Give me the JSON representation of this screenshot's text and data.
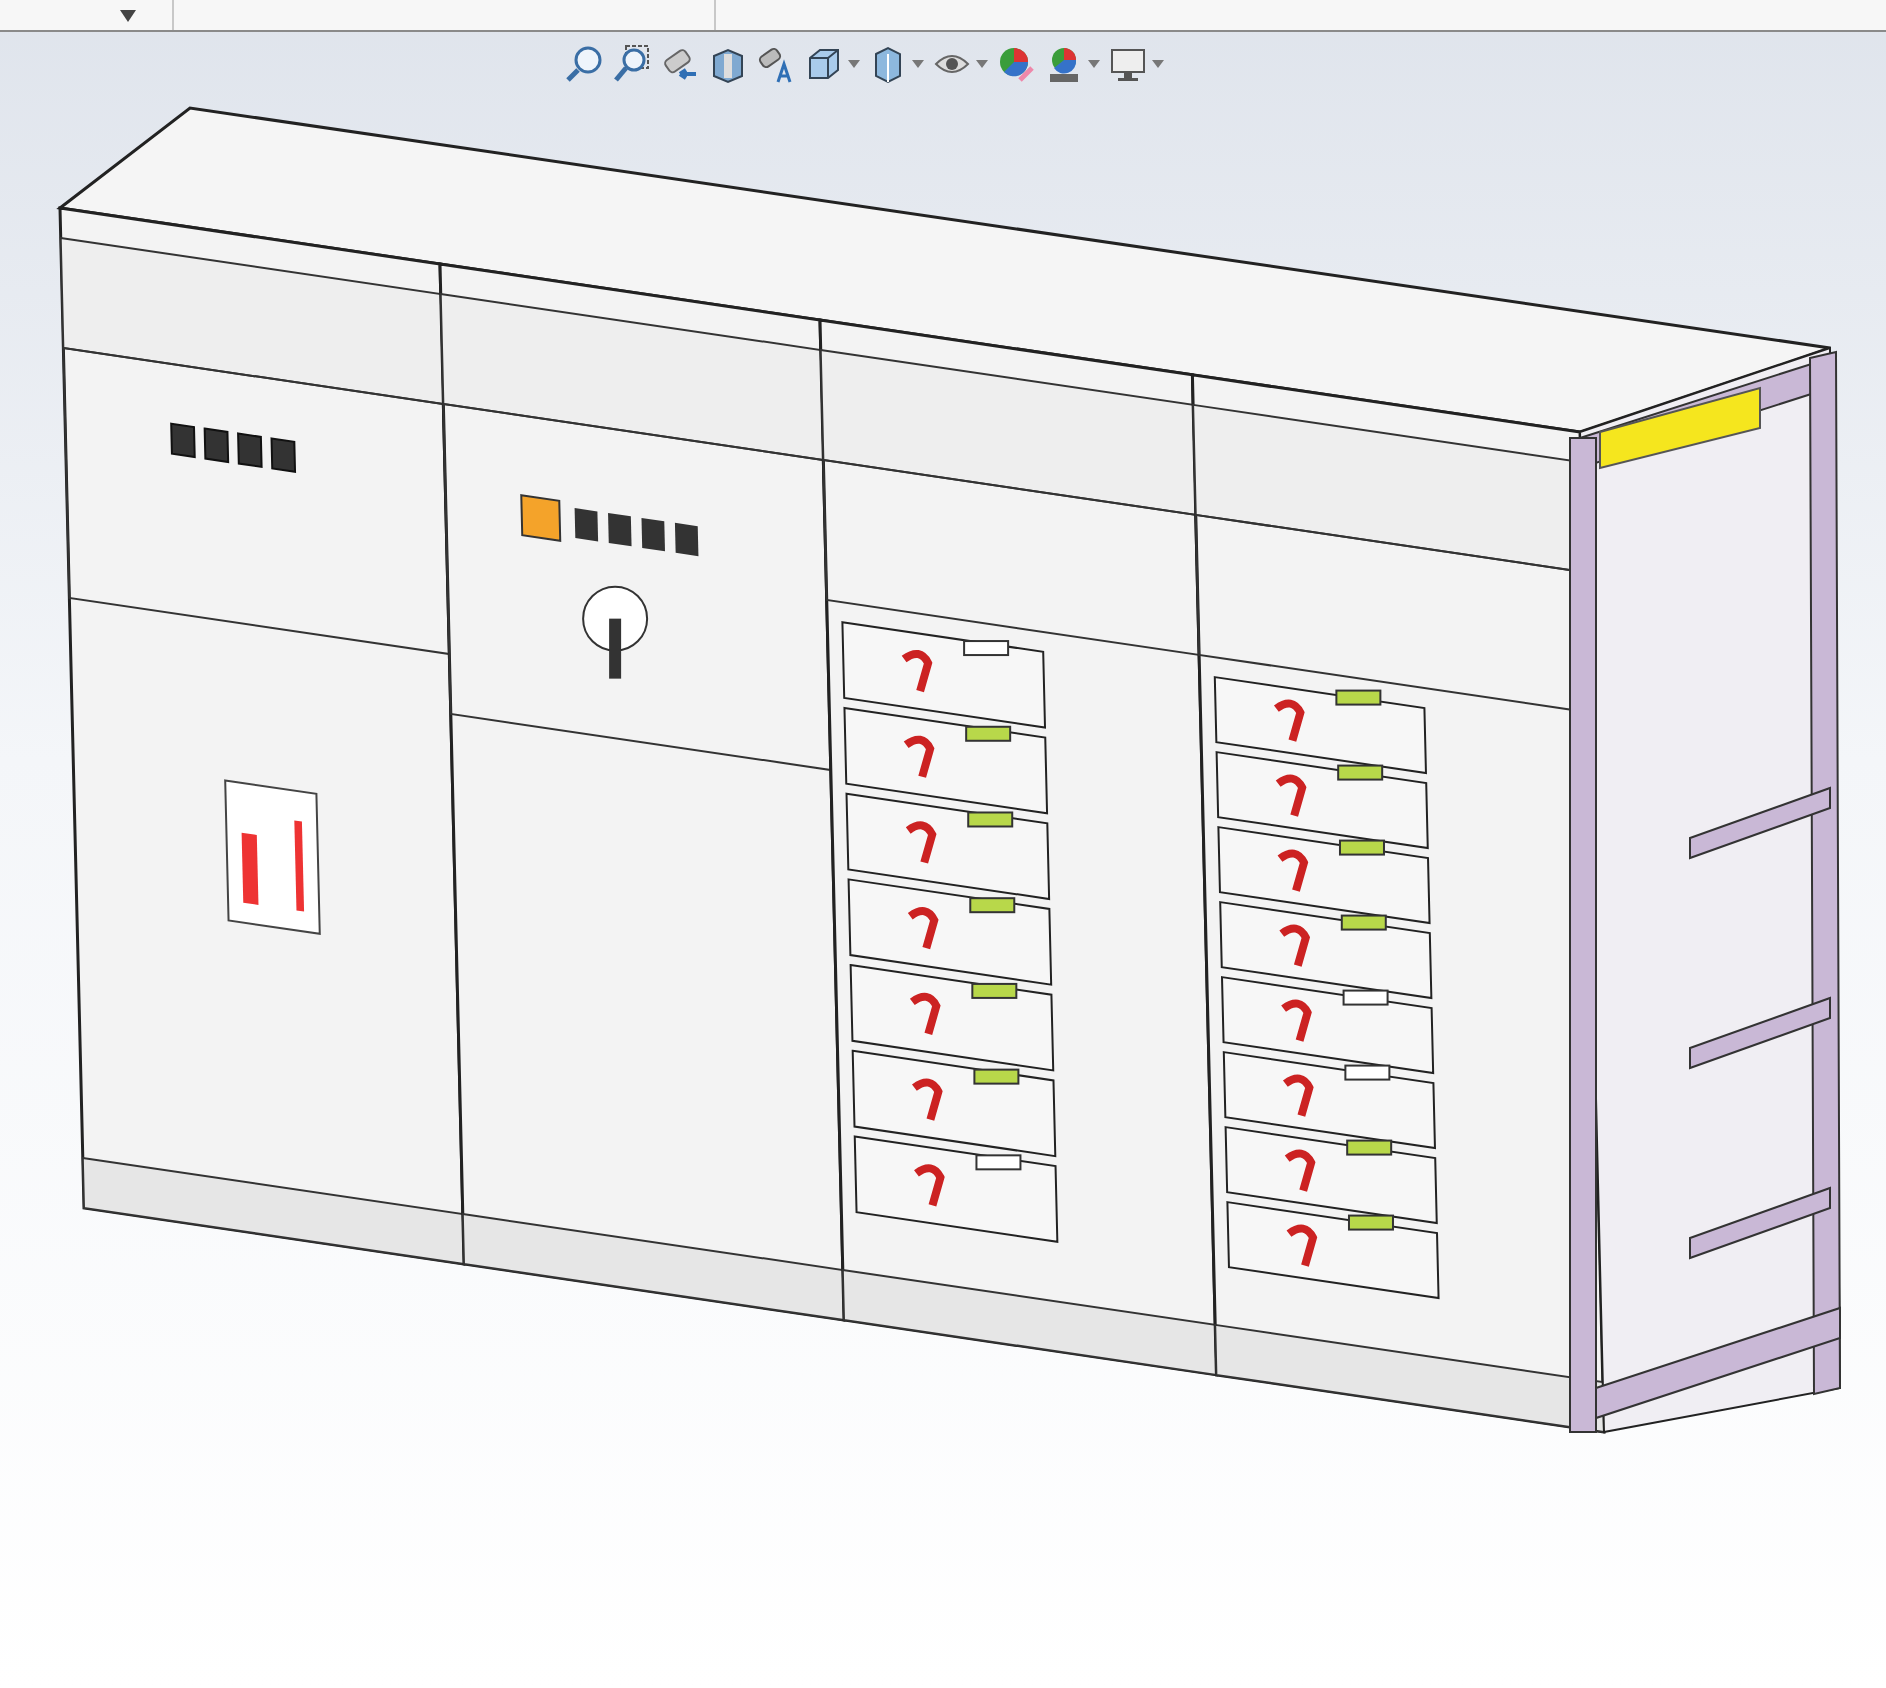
{
  "heads_up_toolbar": [
    {
      "kind": "zoom-fit",
      "dropdown": false
    },
    {
      "kind": "zoom-area",
      "dropdown": false
    },
    {
      "kind": "previous-view",
      "dropdown": false
    },
    {
      "kind": "section-view",
      "dropdown": false
    },
    {
      "kind": "annotation",
      "dropdown": false
    },
    {
      "kind": "view-orientation",
      "dropdown": true
    },
    {
      "kind": "display-style",
      "dropdown": true
    },
    {
      "kind": "hide-show",
      "dropdown": true
    },
    {
      "kind": "appearance",
      "dropdown": false
    },
    {
      "kind": "scene",
      "dropdown": true
    },
    {
      "kind": "display-settings",
      "dropdown": true
    }
  ],
  "model": {
    "sections": [
      {
        "kind": "incoming"
      },
      {
        "kind": "switch"
      },
      {
        "kind": "drawers",
        "drawers": [
          {
            "kind": "lamps"
          },
          {
            "kind": "meters"
          },
          {
            "kind": "meters"
          },
          {
            "kind": "meters"
          },
          {
            "kind": "meters"
          },
          {
            "kind": "meters"
          },
          {
            "kind": "lamps"
          }
        ]
      },
      {
        "kind": "drawers",
        "drawers": [
          {
            "kind": "meters"
          },
          {
            "kind": "meters"
          },
          {
            "kind": "meters"
          },
          {
            "kind": "meters"
          },
          {
            "kind": "lamps"
          },
          {
            "kind": "lamps"
          },
          {
            "kind": "meters"
          },
          {
            "kind": "meters"
          }
        ]
      },
      {
        "kind": "frame"
      }
    ]
  }
}
